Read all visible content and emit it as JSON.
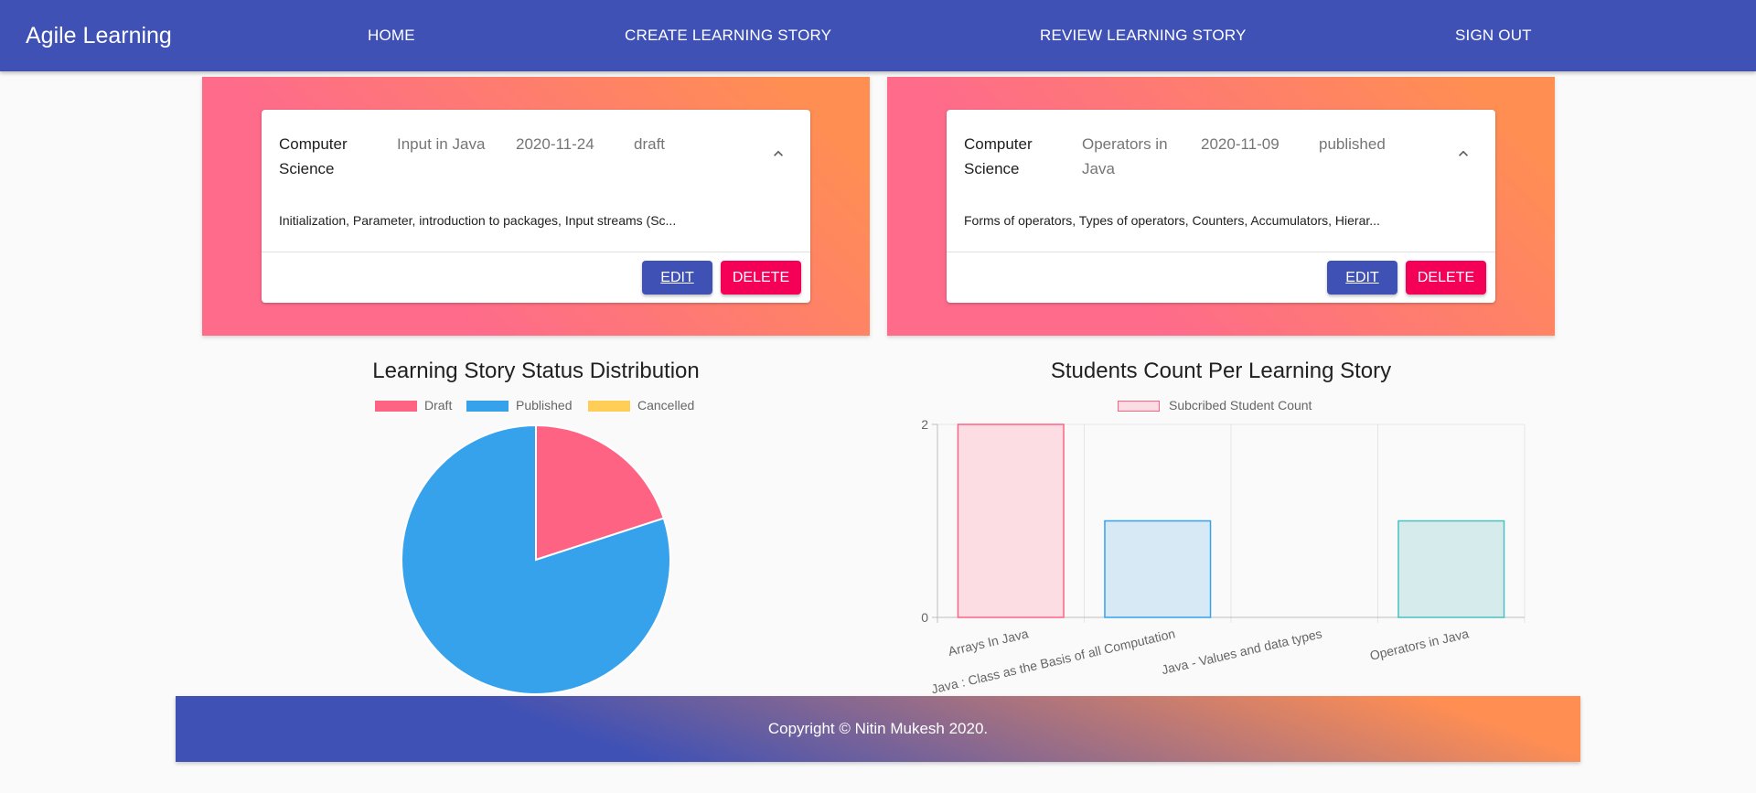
{
  "app": {
    "title": "Agile Learning"
  },
  "nav": {
    "home": "HOME",
    "create": "CREATE LEARNING STORY",
    "review": "REVIEW LEARNING STORY",
    "signout": "SIGN OUT"
  },
  "stories": [
    {
      "subject": "Computer Science",
      "topic": "Input in Java",
      "date": "2020-11-24",
      "status": "draft",
      "description": "Initialization, Parameter, introduction to packages, Input streams (Sc...",
      "edit_label": "EDIT",
      "delete_label": "DELETE"
    },
    {
      "subject": "Computer Science",
      "topic": "Operators in Java",
      "date": "2020-11-09",
      "status": "published",
      "description": "Forms of operators, Types of operators, Counters, Accumulators, Hierar...",
      "edit_label": "EDIT",
      "delete_label": "DELETE"
    }
  ],
  "colors": {
    "primary": "#3f51b5",
    "secondary": "#f50057",
    "draft": "#ff6384",
    "published": "#36a2eb",
    "cancelled": "#ffce56"
  },
  "chart_data": [
    {
      "type": "pie",
      "title": "Learning Story Status Distribution",
      "categories": [
        "Draft",
        "Published",
        "Cancelled"
      ],
      "values": [
        1,
        4,
        0
      ],
      "colors": [
        "#ff6384",
        "#36a2eb",
        "#ffce56"
      ],
      "legend": "top"
    },
    {
      "type": "bar",
      "title": "Students Count Per Learning Story",
      "categories": [
        "Arrays In Java",
        "Java : Class as the Basis of all Computation",
        "Java - Values and data types",
        "Operators in Java"
      ],
      "series": [
        {
          "name": "Subcribed Student Count",
          "values": [
            2,
            1,
            0,
            1
          ]
        }
      ],
      "y_ticks": [
        "0",
        "2"
      ],
      "ylim": [
        0,
        2
      ],
      "grid": true,
      "legend": "top",
      "bar_fill": [
        "#fbdde3",
        "#d7e9f5",
        "#fbdde3",
        "#d6ecec"
      ],
      "bar_stroke": [
        "#ff6384",
        "#36a2eb",
        "#ff6384",
        "#4bc0c0"
      ]
    }
  ],
  "footer": {
    "text": "Copyright © Nitin Mukesh 2020."
  }
}
